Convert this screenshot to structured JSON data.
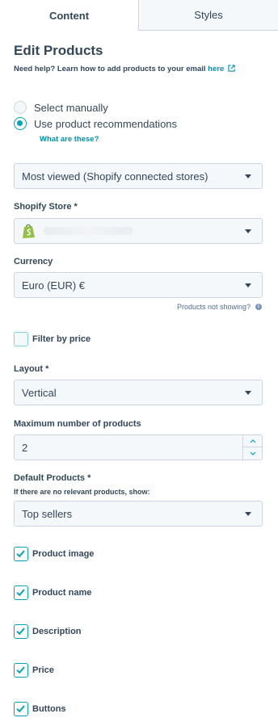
{
  "tabs": {
    "content": "Content",
    "styles": "Styles"
  },
  "header": {
    "title": "Edit Products",
    "help_text": "Need help? Learn how to add products to your email ",
    "help_link": "here"
  },
  "source": {
    "options": [
      "Select manually",
      "Use product recommendations"
    ],
    "selected": "Use product recommendations",
    "what_link": "What are these?"
  },
  "recommendation": {
    "value": "Most viewed (Shopify connected stores)"
  },
  "store": {
    "label": "Shopify Store *",
    "value": ""
  },
  "currency": {
    "label": "Currency",
    "value": "Euro (EUR) €",
    "hint": "Products not showing?"
  },
  "filter_price": {
    "label": "Filter by price",
    "checked": false
  },
  "layout": {
    "label": "Layout *",
    "value": "Vertical"
  },
  "max_products": {
    "label": "Maximum number of products",
    "value": "2"
  },
  "default_products": {
    "label": "Default Products *",
    "sub_label": "If there are no relevant products, show:",
    "value": "Top sellers"
  },
  "options": [
    {
      "label": "Product image",
      "checked": true
    },
    {
      "label": "Product name",
      "checked": true
    },
    {
      "label": "Description",
      "checked": true
    },
    {
      "label": "Price",
      "checked": true
    },
    {
      "label": "Buttons",
      "checked": true
    }
  ],
  "colors": {
    "accent": "#00a4bd",
    "link": "#0091ae",
    "text": "#33475b",
    "border": "#cbd6e2",
    "field_bg": "#f5f8fa",
    "shopify_green": "#95bf47"
  }
}
